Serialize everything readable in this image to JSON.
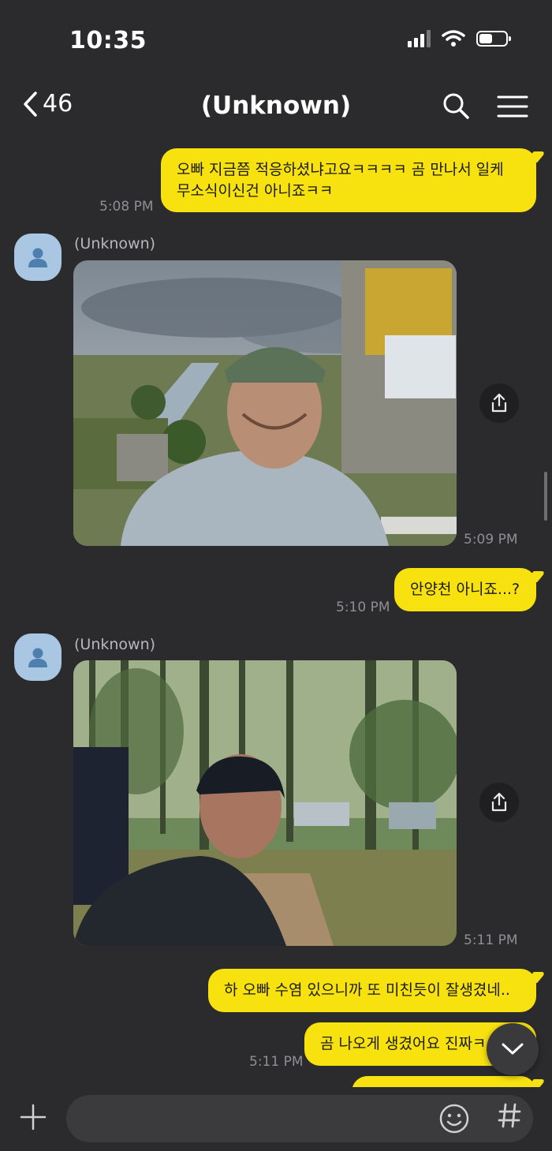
{
  "status_bar": {
    "time": "10:35"
  },
  "header": {
    "back_count": "46",
    "title": "(Unknown)"
  },
  "messages": {
    "m1": {
      "text": "오빠 지금쯤 적응하셨냐고요ㅋㅋㅋㅋ 곰 만나서 일케 무소식이신건 아니죠ㅋㅋ",
      "time": "5:08 PM"
    },
    "p1": {
      "sender": "(Unknown)",
      "time": "5:09 PM"
    },
    "m2": {
      "text": "안양천 아니죠...?",
      "time": "5:10 PM"
    },
    "p2": {
      "sender": "(Unknown)",
      "time": "5:11 PM"
    },
    "m3": {
      "text": "하 오빠 수염 있으니까 또 미친듯이 잘생겼네.."
    },
    "m4": {
      "text": "곰 나오게 생겼어요 진짜ㅋ",
      "time": "5:11 PM"
    }
  },
  "composer": {
    "placeholder": ""
  },
  "colors": {
    "bubble_out": "#f7e20f",
    "background": "#2b2b2d",
    "avatar": "#a9c6e3"
  }
}
